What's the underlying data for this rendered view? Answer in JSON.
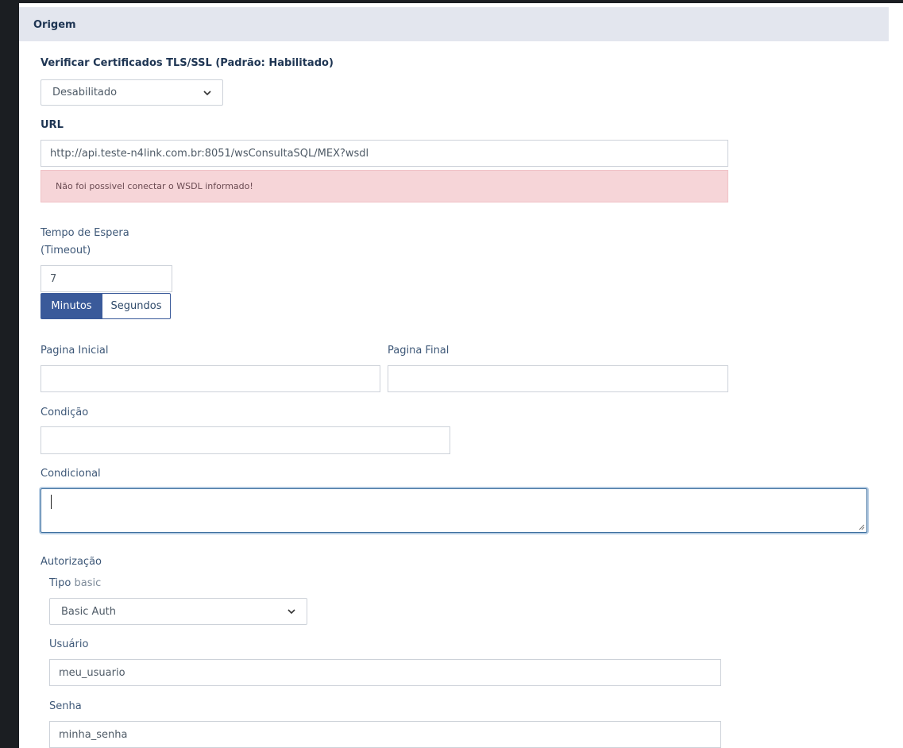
{
  "panel": {
    "title": "Origem"
  },
  "tls": {
    "label": "Verificar Certificados TLS/SSL (Padrão: Habilitado)",
    "selected": "Desabilitado"
  },
  "url": {
    "label": "URL",
    "value": "http://api.teste-n4link.com.br:8051/wsConsultaSQL/MEX?wsdl",
    "error": "Não foi possivel conectar o WSDL informado!"
  },
  "timeout": {
    "label_line1": "Tempo de Espera",
    "label_line2": "(Timeout)",
    "value": "7",
    "unit_minutes": "Minutos",
    "unit_seconds": "Segundos"
  },
  "pages": {
    "start_label": "Pagina Inicial",
    "start_value": "",
    "end_label": "Pagina Final",
    "end_value": ""
  },
  "condition": {
    "label": "Condição",
    "value": ""
  },
  "conditional": {
    "label": "Condicional",
    "value": ""
  },
  "auth": {
    "label": "Autorização",
    "type_label": "Tipo",
    "type_hint": "basic",
    "type_selected": "Basic Auth",
    "user_label": "Usuário",
    "user_value": "meu_usuario",
    "password_label": "Senha",
    "password_value": "minha_senha"
  },
  "colors": {
    "accent": "#3a5a9a",
    "alert_bg": "#f6d5d8",
    "header_bg": "#e3e6ee"
  }
}
